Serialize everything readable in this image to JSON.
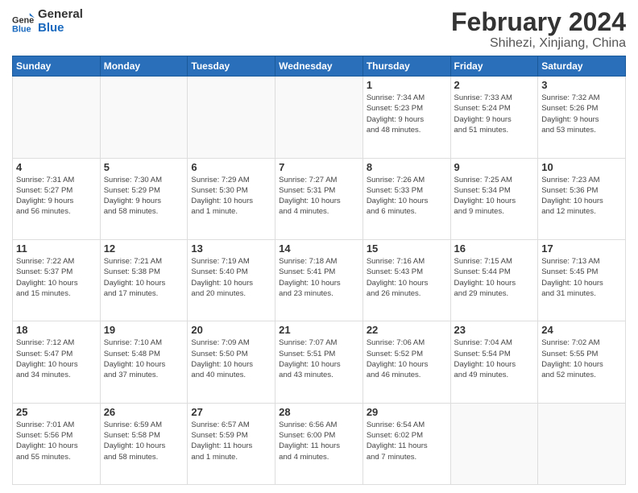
{
  "logo": {
    "text_general": "General",
    "text_blue": "Blue"
  },
  "header": {
    "month_year": "February 2024",
    "location": "Shihezi, Xinjiang, China"
  },
  "days_of_week": [
    "Sunday",
    "Monday",
    "Tuesday",
    "Wednesday",
    "Thursday",
    "Friday",
    "Saturday"
  ],
  "weeks": [
    [
      {
        "day": "",
        "info": ""
      },
      {
        "day": "",
        "info": ""
      },
      {
        "day": "",
        "info": ""
      },
      {
        "day": "",
        "info": ""
      },
      {
        "day": "1",
        "info": "Sunrise: 7:34 AM\nSunset: 5:23 PM\nDaylight: 9 hours\nand 48 minutes."
      },
      {
        "day": "2",
        "info": "Sunrise: 7:33 AM\nSunset: 5:24 PM\nDaylight: 9 hours\nand 51 minutes."
      },
      {
        "day": "3",
        "info": "Sunrise: 7:32 AM\nSunset: 5:26 PM\nDaylight: 9 hours\nand 53 minutes."
      }
    ],
    [
      {
        "day": "4",
        "info": "Sunrise: 7:31 AM\nSunset: 5:27 PM\nDaylight: 9 hours\nand 56 minutes."
      },
      {
        "day": "5",
        "info": "Sunrise: 7:30 AM\nSunset: 5:29 PM\nDaylight: 9 hours\nand 58 minutes."
      },
      {
        "day": "6",
        "info": "Sunrise: 7:29 AM\nSunset: 5:30 PM\nDaylight: 10 hours\nand 1 minute."
      },
      {
        "day": "7",
        "info": "Sunrise: 7:27 AM\nSunset: 5:31 PM\nDaylight: 10 hours\nand 4 minutes."
      },
      {
        "day": "8",
        "info": "Sunrise: 7:26 AM\nSunset: 5:33 PM\nDaylight: 10 hours\nand 6 minutes."
      },
      {
        "day": "9",
        "info": "Sunrise: 7:25 AM\nSunset: 5:34 PM\nDaylight: 10 hours\nand 9 minutes."
      },
      {
        "day": "10",
        "info": "Sunrise: 7:23 AM\nSunset: 5:36 PM\nDaylight: 10 hours\nand 12 minutes."
      }
    ],
    [
      {
        "day": "11",
        "info": "Sunrise: 7:22 AM\nSunset: 5:37 PM\nDaylight: 10 hours\nand 15 minutes."
      },
      {
        "day": "12",
        "info": "Sunrise: 7:21 AM\nSunset: 5:38 PM\nDaylight: 10 hours\nand 17 minutes."
      },
      {
        "day": "13",
        "info": "Sunrise: 7:19 AM\nSunset: 5:40 PM\nDaylight: 10 hours\nand 20 minutes."
      },
      {
        "day": "14",
        "info": "Sunrise: 7:18 AM\nSunset: 5:41 PM\nDaylight: 10 hours\nand 23 minutes."
      },
      {
        "day": "15",
        "info": "Sunrise: 7:16 AM\nSunset: 5:43 PM\nDaylight: 10 hours\nand 26 minutes."
      },
      {
        "day": "16",
        "info": "Sunrise: 7:15 AM\nSunset: 5:44 PM\nDaylight: 10 hours\nand 29 minutes."
      },
      {
        "day": "17",
        "info": "Sunrise: 7:13 AM\nSunset: 5:45 PM\nDaylight: 10 hours\nand 31 minutes."
      }
    ],
    [
      {
        "day": "18",
        "info": "Sunrise: 7:12 AM\nSunset: 5:47 PM\nDaylight: 10 hours\nand 34 minutes."
      },
      {
        "day": "19",
        "info": "Sunrise: 7:10 AM\nSunset: 5:48 PM\nDaylight: 10 hours\nand 37 minutes."
      },
      {
        "day": "20",
        "info": "Sunrise: 7:09 AM\nSunset: 5:50 PM\nDaylight: 10 hours\nand 40 minutes."
      },
      {
        "day": "21",
        "info": "Sunrise: 7:07 AM\nSunset: 5:51 PM\nDaylight: 10 hours\nand 43 minutes."
      },
      {
        "day": "22",
        "info": "Sunrise: 7:06 AM\nSunset: 5:52 PM\nDaylight: 10 hours\nand 46 minutes."
      },
      {
        "day": "23",
        "info": "Sunrise: 7:04 AM\nSunset: 5:54 PM\nDaylight: 10 hours\nand 49 minutes."
      },
      {
        "day": "24",
        "info": "Sunrise: 7:02 AM\nSunset: 5:55 PM\nDaylight: 10 hours\nand 52 minutes."
      }
    ],
    [
      {
        "day": "25",
        "info": "Sunrise: 7:01 AM\nSunset: 5:56 PM\nDaylight: 10 hours\nand 55 minutes."
      },
      {
        "day": "26",
        "info": "Sunrise: 6:59 AM\nSunset: 5:58 PM\nDaylight: 10 hours\nand 58 minutes."
      },
      {
        "day": "27",
        "info": "Sunrise: 6:57 AM\nSunset: 5:59 PM\nDaylight: 11 hours\nand 1 minute."
      },
      {
        "day": "28",
        "info": "Sunrise: 6:56 AM\nSunset: 6:00 PM\nDaylight: 11 hours\nand 4 minutes."
      },
      {
        "day": "29",
        "info": "Sunrise: 6:54 AM\nSunset: 6:02 PM\nDaylight: 11 hours\nand 7 minutes."
      },
      {
        "day": "",
        "info": ""
      },
      {
        "day": "",
        "info": ""
      }
    ]
  ]
}
